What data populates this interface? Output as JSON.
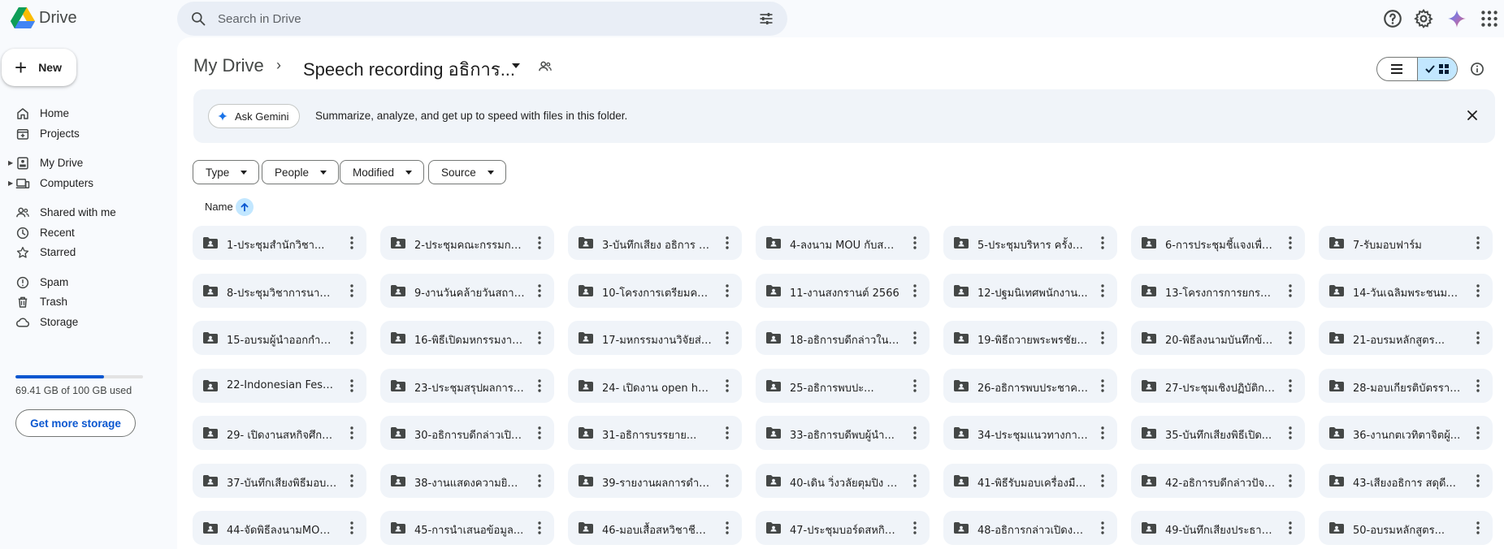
{
  "app": {
    "name": "Drive"
  },
  "search": {
    "placeholder": "Search in Drive"
  },
  "sidebar": {
    "new_label": "New",
    "items": [
      {
        "label": "Home",
        "icon": "home-icon"
      },
      {
        "label": "Projects",
        "icon": "projects-icon"
      },
      {
        "label": "My Drive",
        "icon": "my-drive-icon"
      },
      {
        "label": "Computers",
        "icon": "computers-icon"
      },
      {
        "label": "Shared with me",
        "icon": "shared-icon"
      },
      {
        "label": "Recent",
        "icon": "clock-icon"
      },
      {
        "label": "Starred",
        "icon": "star-icon"
      },
      {
        "label": "Spam",
        "icon": "spam-icon"
      },
      {
        "label": "Trash",
        "icon": "trash-icon"
      },
      {
        "label": "Storage",
        "icon": "cloud-icon"
      }
    ],
    "storage": {
      "used_fraction": 0.6941,
      "text": "69.41 GB of 100 GB used",
      "button": "Get more storage"
    }
  },
  "breadcrumb": {
    "root": "My Drive",
    "separator": "›",
    "current": "Speech recording อธิการ..."
  },
  "gemini": {
    "button": "Ask Gemini",
    "text": "Summarize, analyze, and get up to speed with files in this folder."
  },
  "filters": [
    "Type",
    "People",
    "Modified",
    "Source"
  ],
  "sort": {
    "label": "Name"
  },
  "colors": {
    "accent": "#0b57d0",
    "folder_bg": "#f0f4f9",
    "active_toggle": "#c2e7ff"
  },
  "folders": [
    "1-ประชุมสำนักวิชา...",
    "2-ประชุมคณะกรรมการ...",
    "3-บันทึกเสียง อธิการ งาน...",
    "4-ลงนาม MOU กับสมาค...",
    "5-ประชุมบริหาร ครั้งที่ 2-...",
    "6-การประชุมชี้แจงเพื่อขับ...",
    "7-รับมอบฟาร์ม",
    "8-ประชุมวิชาการนานาชาติ...",
    "9-งานวันคล้ายวันสถาปนา...",
    "10-โครงการเตรียมความ...",
    "11-งานสงกรานต์ 2566",
    "12-ปฐมนิเทศพนักงาน...",
    "13-โครงการการยกระดับ...",
    "14-วันเฉลิมพระชนมพรร...",
    "15-อบรมผู้นำออกกำลังกา...",
    "16-พิธีเปิดมหกรรมงานวิจั...",
    "17-มหกรรมงานวิจัยส่วน...",
    "18-อธิการบดีกล่าวในพิธีใ...",
    "19-พิธีถวายพระพรชัยมง...",
    "20-พิธีลงนามบันทึกข้อ...",
    "21-อบรมหลักสูตร...",
    "22-Indonesian Festiva...",
    "23-ประชุมสรุปผลการรับ...",
    "24- เปิดงาน open hous...",
    "25-อธิการพบปะ...",
    "26-อธิการพบประชาคม...",
    "27-ประชุมเชิงปฏิบัติการก...",
    "28-มอบเกียรติบัตรรางวัล...",
    "29- เปิดงานสหกิจศึกษา 1...",
    "30-อธิการบดีกล่าวเปิดงา...",
    "31-อธิการบรรยาย...",
    "33-อธิการบดีพบผู้นำ...",
    "34-ประชุมแนวทางการจัด...",
    "35-บันทึกเสียงพิธีเปิด...",
    "36-งานกตเวทิตาจิตผู้...",
    "37-บันทึกเสียงพิธีมอบช่อ...",
    "38-งานแสดงความยินดีแ...",
    "39-รายงานผลการดำเนิน...",
    "40-เดิน วิ่งวลัยตุมปิง 30...",
    "41-พิธีรับมอบเครื่องมือ...",
    "42-อธิการบดีกล่าวปัจฉิม...",
    "43-เสียงอธิการ สดุดี...",
    "44-จัดพิธีลงนามMOU...",
    "45-การนำเสนอข้อมูล...",
    "46-มอบเสื้อสหวิชาชีพกา...",
    "47-ประชุมบอร์ดสหกิจ...",
    "48-อธิการกล่าวเปิดงาน...",
    "49-บันทึกเสียงประธานเปิ...",
    "50-อบรมหลักสูตร..."
  ]
}
